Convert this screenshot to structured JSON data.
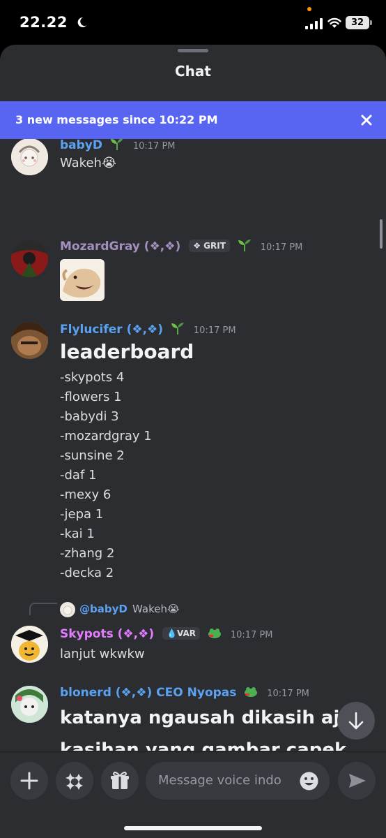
{
  "status_bar": {
    "time": "22.22",
    "battery": "32"
  },
  "header": {
    "title": "Chat"
  },
  "banner": {
    "text": "3 new messages since 10:22 PM"
  },
  "messages": [
    {
      "username": "babyD",
      "color": "#5ba3f2",
      "time": "10:17 PM",
      "text": "Wakeh😭"
    },
    {
      "username": "MozardGray (❖,❖)",
      "color": "#a58fbf",
      "tag": "❖ GRIT",
      "time": "10:17 PM"
    },
    {
      "username": "Flylucifer (❖,❖)",
      "color": "#5ba3f2",
      "time": "10:17 PM",
      "title": "leaderboard",
      "items": [
        "-skypots 4",
        "-flowers 1",
        "-babydi 3",
        "-mozardgray 1",
        "-sunsine 2",
        "-daf 1",
        "-mexy 6",
        "-jepa 1",
        "-kai 1",
        "-zhang 2",
        "-decka 2"
      ]
    },
    {
      "reply_to": "@babyD",
      "reply_text": "Wakeh😭",
      "username": "Skypots  (❖,❖)",
      "color": "#e37cff",
      "tag": "💧VAR",
      "time": "10:17 PM",
      "text": "lanjut wkwkw"
    },
    {
      "username": "blonerd (❖,❖) CEO Nyopas",
      "color": "#5ba3f2",
      "time": "10:17 PM",
      "text": "katanya ngausah dikasih aja kasihan yang gambar capek katanya"
    }
  ],
  "composer": {
    "placeholder": "Message voice indo"
  }
}
